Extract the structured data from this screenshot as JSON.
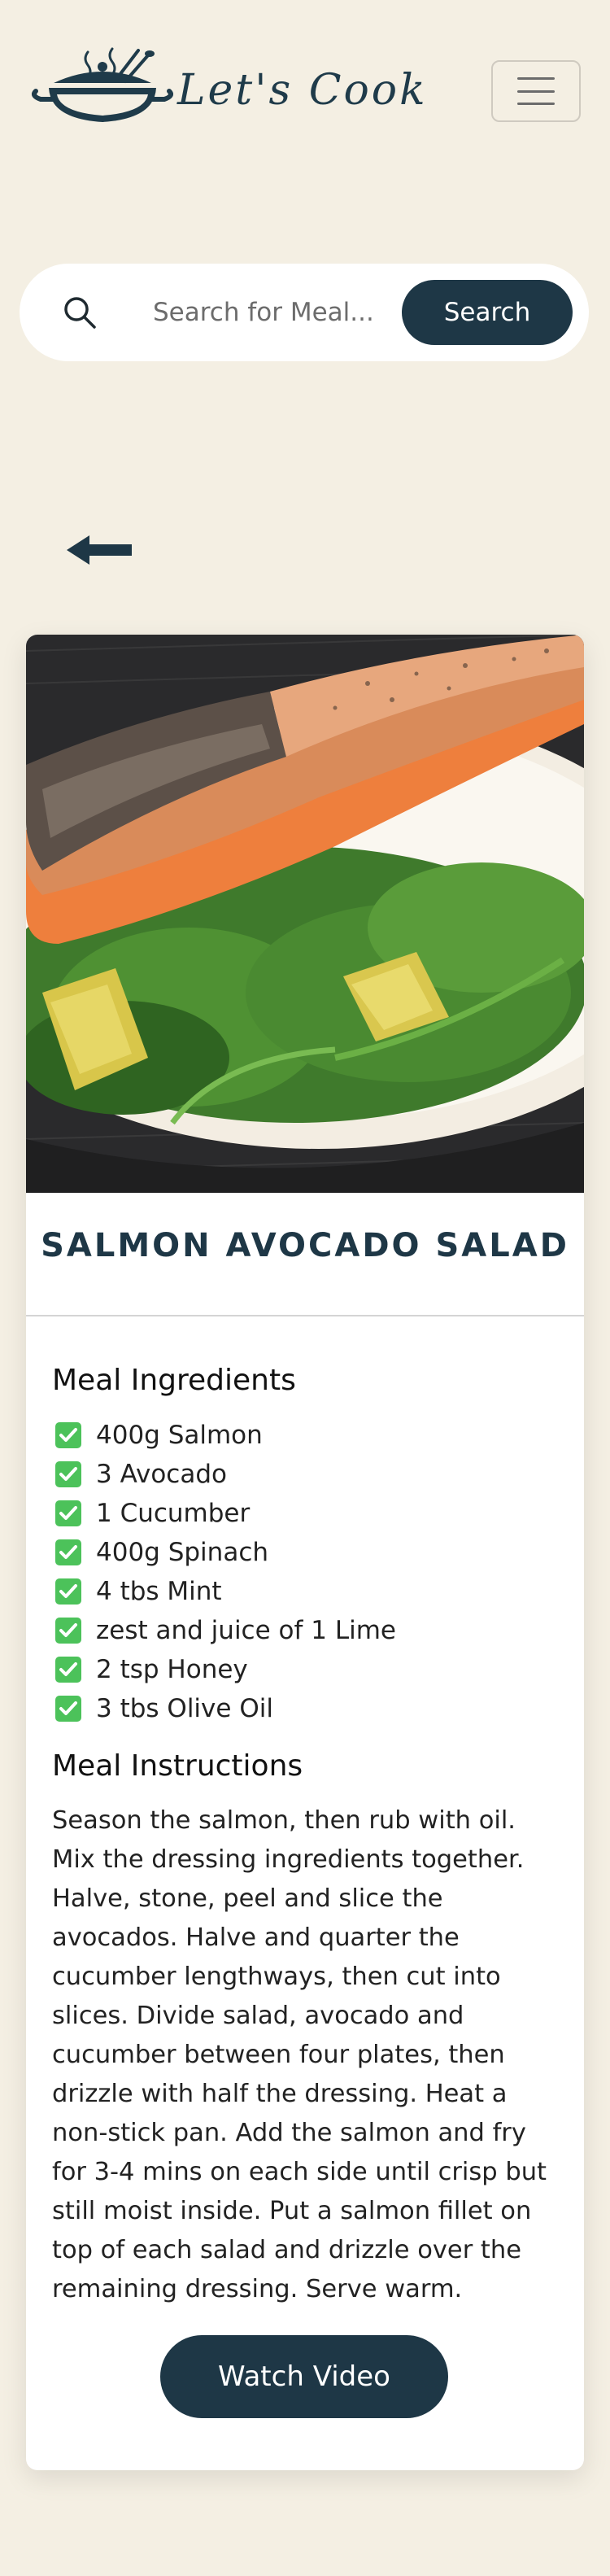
{
  "header": {
    "brand_name": "Let's Cook",
    "logo_icon": "cooking-pot-icon",
    "menu_icon": "hamburger-menu-icon"
  },
  "search": {
    "icon": "search-icon",
    "placeholder": "Search for Meal...",
    "value": "",
    "button_label": "Search"
  },
  "navigation": {
    "back_icon": "arrow-left-icon"
  },
  "meal": {
    "image": "salmon-avocado-salad-photo",
    "title": "SALMON AVOCADO SALAD",
    "ingredients_heading": "Meal Ingredients",
    "ingredient_icon": "checkbox-checked-icon",
    "ingredients": [
      "400g Salmon",
      "3 Avocado",
      "1 Cucumber",
      "400g Spinach",
      "4 tbs Mint",
      "zest and juice of 1 Lime",
      "2 tsp Honey",
      "3 tbs Olive Oil"
    ],
    "instructions_heading": "Meal Instructions",
    "instructions": "Season the salmon, then rub with oil. Mix the dressing ingredients together. Halve, stone, peel and slice the avocados. Halve and quarter the cucumber lengthways, then cut into slices. Divide salad, avocado and cucumber between four plates, then drizzle with half the dressing. Heat a non-stick pan. Add the salmon and fry for 3-4 mins on each side until crisp but still moist inside. Put a salmon fillet on top of each salad and drizzle over the remaining dressing. Serve warm.",
    "video_button_label": "Watch Video"
  },
  "colors": {
    "page_background": "#f4efe3",
    "primary_dark": "#1e3746",
    "card_background": "#ffffff",
    "check_green": "#4cc25a"
  }
}
